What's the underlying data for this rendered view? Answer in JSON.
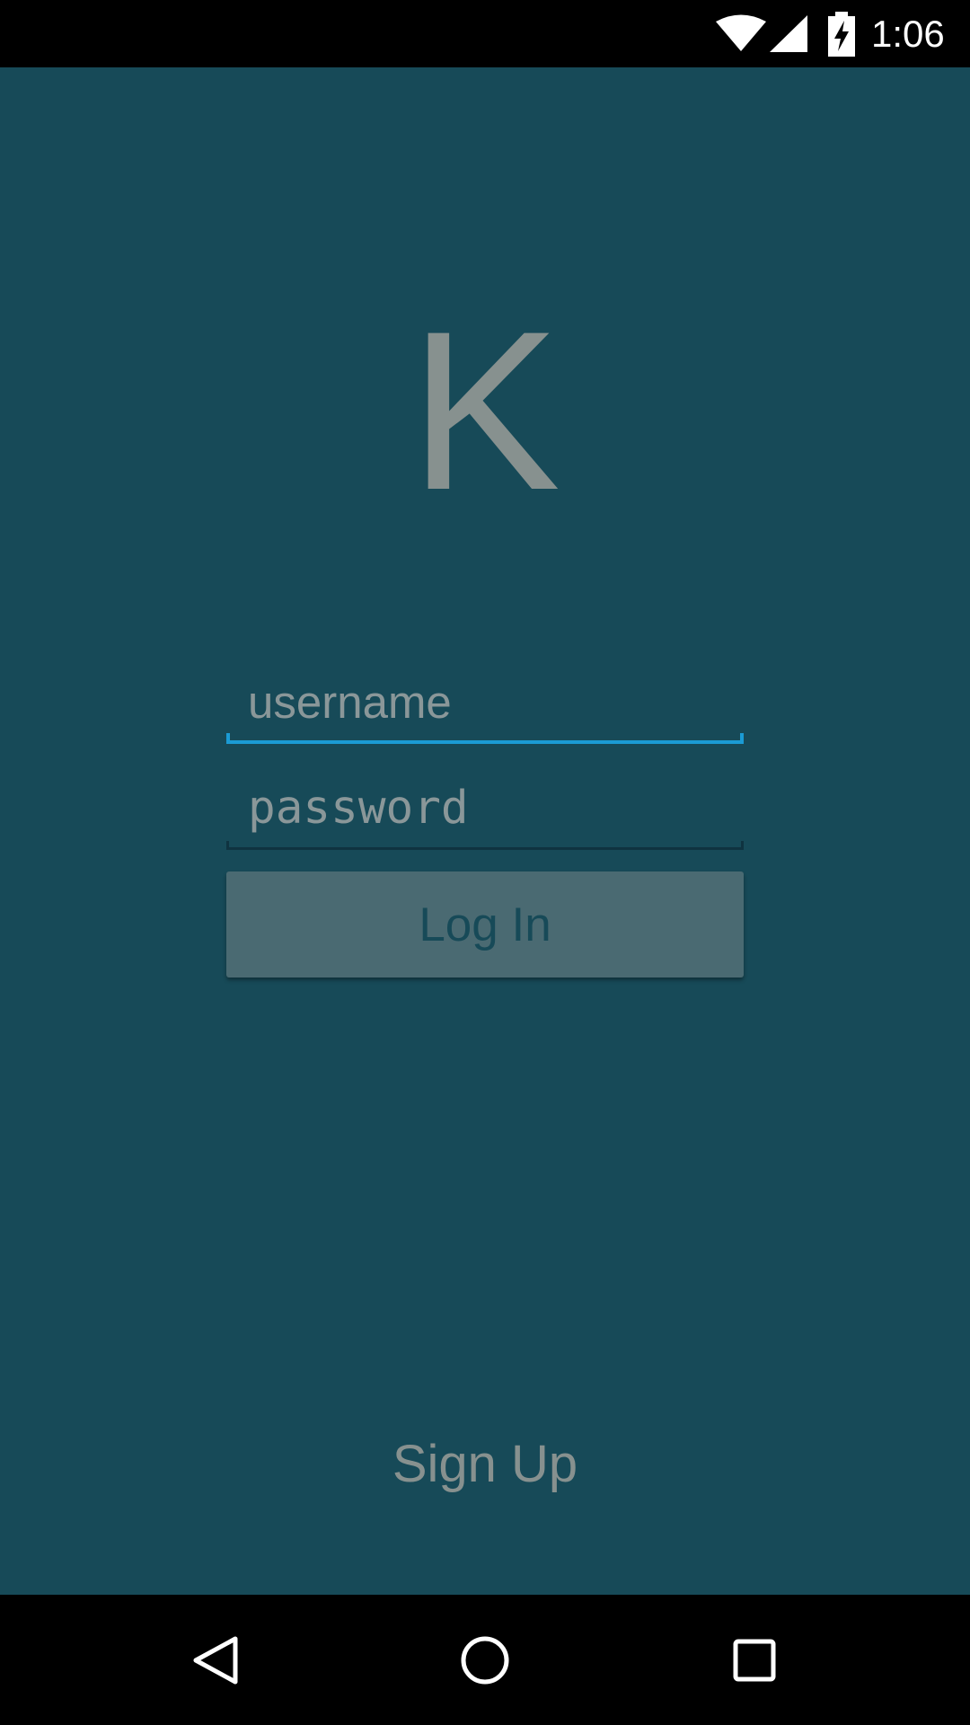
{
  "status_bar": {
    "time": "1:06",
    "icons": [
      "wifi-icon",
      "cell-signal-icon",
      "battery-charging-icon"
    ]
  },
  "logo": {
    "text": "K"
  },
  "login_form": {
    "username_placeholder": "username",
    "username_value": "",
    "password_placeholder": "password",
    "password_value": "",
    "login_label": "Log In"
  },
  "signup": {
    "label": "Sign Up"
  },
  "nav_bar": {
    "icons": [
      "back-icon",
      "home-icon",
      "recents-icon"
    ]
  },
  "colors": {
    "background": "#174a58",
    "accent": "#1b9bd4",
    "button": "#4a6a72",
    "muted_text": "#87918f"
  }
}
